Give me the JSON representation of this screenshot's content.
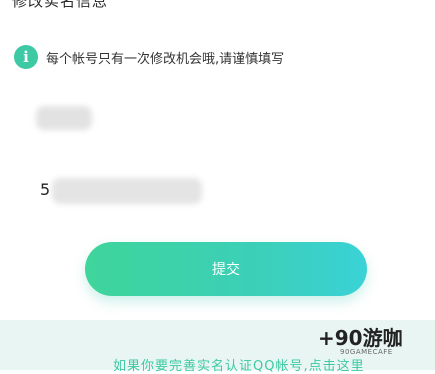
{
  "page": {
    "title": "修改实名信息"
  },
  "notice": {
    "icon": "info-icon",
    "text": "每个帐号只有一次修改机会哦,请谨慎填写"
  },
  "form": {
    "id_prefix": "5"
  },
  "submit": {
    "label": "提交"
  },
  "footer": {
    "text": "如果你要完善实名认证QQ帐号,点击这里"
  },
  "watermark": {
    "brand": "+90游咖",
    "sub": "90GAMECAFE"
  },
  "colors": {
    "accent": "#3cc9a3",
    "button_start": "#3fd59b",
    "button_end": "#3ad2d6",
    "footer_bg": "#e9f5f3"
  }
}
